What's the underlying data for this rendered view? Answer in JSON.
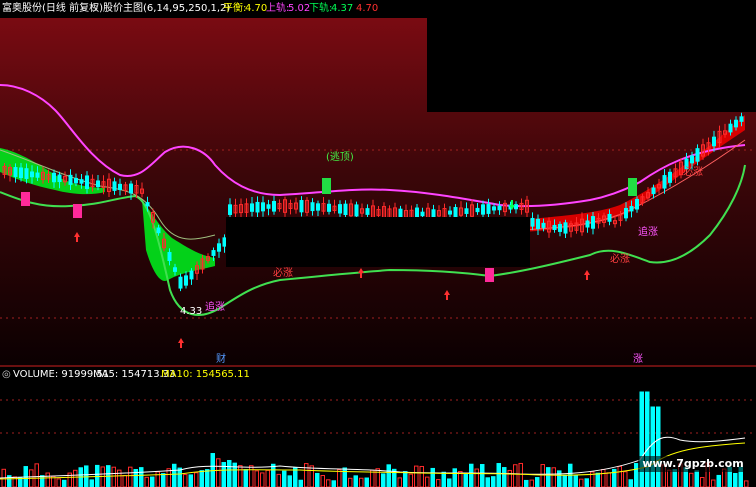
{
  "header": {
    "stock_name": "富奥股份(日线 前复权)",
    "indicator_icon": "circle-dot-icon",
    "indicator_name": "股价主图(6,14,95,250,1,2)",
    "balance_label": "平衡:",
    "balance_value": "4.70",
    "upper_label": "上轨:",
    "upper_value": "5.02",
    "lower_label": "下轨:",
    "lower_value": "4.37",
    "extra_value": "4.70"
  },
  "chart_labels": {
    "escape": "(逃顶)",
    "chase1": "追涨",
    "chase2": "追涨",
    "must_rise1": "必涨",
    "must_rise2": "必涨",
    "must_rise3": "必涨",
    "low_price": "4.33",
    "cai": "财",
    "zhang": "涨"
  },
  "volume": {
    "icon": "circle-icon",
    "label": "VOLUME: 91999.51",
    "ma5": "MA5: 154713.33",
    "ma10": "MA10: 154565.11"
  },
  "watermark": "www.7gpzb.com",
  "colors": {
    "balance": "#ffff00",
    "upper": "#ff44ff",
    "lower": "#00ff55",
    "ma5": "#ffffff",
    "ma10": "#ffff00",
    "up": "#ff2a2a",
    "down": "#00ffff",
    "band_green": "#00ff22",
    "band_red": "#e00000"
  }
}
